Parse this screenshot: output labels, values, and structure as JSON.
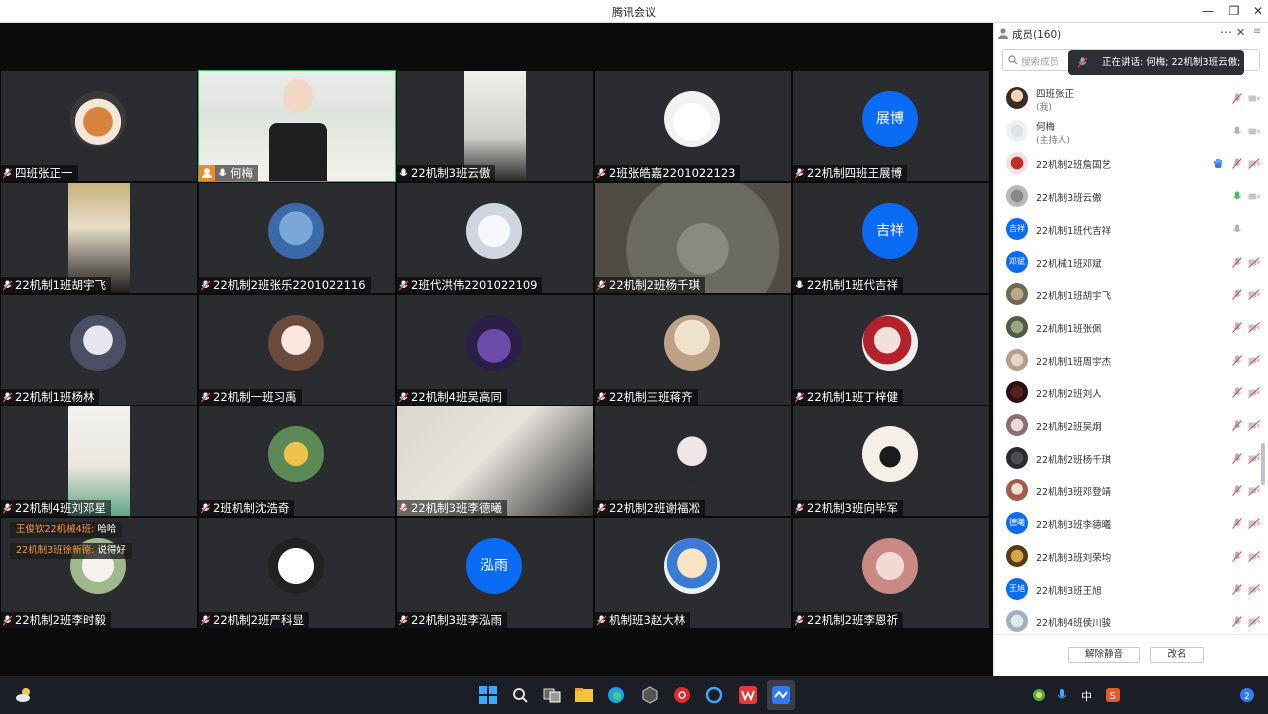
{
  "window": {
    "title": "腾讯会议"
  },
  "tiles": [
    {
      "name": "四班张正一",
      "mic": "muted"
    },
    {
      "name": "何梅",
      "mic": "on",
      "host": true
    },
    {
      "name": "22机制3班云傲",
      "mic": "on"
    },
    {
      "name": "2班张皓嘉2201022123",
      "mic": "muted"
    },
    {
      "name": "22机制四班王展博",
      "mic": "muted",
      "avatar_text": "展博"
    },
    {
      "name": "22机制1班胡宇飞",
      "mic": "muted"
    },
    {
      "name": "22机制2班张乐2201022116",
      "mic": "muted"
    },
    {
      "name": "2班代洪伟2201022109",
      "mic": "muted"
    },
    {
      "name": "22机制2班杨千琪",
      "mic": "muted"
    },
    {
      "name": "22机制1班代吉祥",
      "mic": "on",
      "avatar_text": "吉祥"
    },
    {
      "name": "22机制1班杨林",
      "mic": "muted"
    },
    {
      "name": "22机制一班习禹",
      "mic": "muted"
    },
    {
      "name": "22机制4班吴高同",
      "mic": "muted"
    },
    {
      "name": "22机制三班蒋齐",
      "mic": "muted"
    },
    {
      "name": "22机制1班丁梓健",
      "mic": "muted"
    },
    {
      "name": "22机制4班刘邓星",
      "mic": "muted"
    },
    {
      "name": "2班机制沈浩奇",
      "mic": "muted"
    },
    {
      "name": "22机制3班李德曦",
      "mic": "muted"
    },
    {
      "name": "22机制2班谢福凇",
      "mic": "muted"
    },
    {
      "name": "22机制3班向毕军",
      "mic": "muted"
    },
    {
      "name": "22机制2班李时毅",
      "mic": "muted"
    },
    {
      "name": "22机制2班严科显",
      "mic": "muted"
    },
    {
      "name": "22机制3班李泓雨",
      "mic": "muted",
      "avatar_text": "泓雨"
    },
    {
      "name": "机制班3赵大林",
      "mic": "muted"
    },
    {
      "name": "22机制2班李恩祈",
      "mic": "muted"
    }
  ],
  "chat": [
    {
      "who": "王俊钦22机械4班:",
      "text": "哈哈"
    },
    {
      "who": "22机制3班徐新德:",
      "text": "说得好"
    }
  ],
  "sidebar": {
    "header": "成员(160)",
    "search_placeholder": "搜索成员",
    "speaking": "正在讲话: 何梅; 22机制3班云傲;",
    "members": [
      {
        "name": "四班张正",
        "role": "(我)"
      },
      {
        "name": "何梅",
        "role": "(主持人)"
      },
      {
        "name": "22机制2班詹国艺",
        "hand": true
      },
      {
        "name": "22机制3班云傲",
        "speaking": true
      },
      {
        "name": "22机制1班代吉祥",
        "avatar_text": "吉祥"
      },
      {
        "name": "22机械1班邓斌",
        "avatar_text": "邓斌"
      },
      {
        "name": "22机制1班胡宇飞"
      },
      {
        "name": "22机制1班张佩"
      },
      {
        "name": "22机制1班周宇杰"
      },
      {
        "name": "22机制2班刘人"
      },
      {
        "name": "22机制2班吴炯"
      },
      {
        "name": "22机制2班杨千琪"
      },
      {
        "name": "22机制3班邓登靖"
      },
      {
        "name": "22机制3班李德曦",
        "avatar_text": "德曦"
      },
      {
        "name": "22机制3班刘荣均"
      },
      {
        "name": "22机制3班王旭",
        "avatar_text": "王旭"
      },
      {
        "name": "22机制4班侯川骏"
      }
    ],
    "unmute_all": "解除静音",
    "rename": "改名"
  },
  "taskbar": {
    "ime": "中"
  },
  "colors": {
    "accent": "#0a6cf5",
    "host_badge": "#f08a24",
    "active_border": "#2fbf5f",
    "muted_red": "#e5484d"
  }
}
